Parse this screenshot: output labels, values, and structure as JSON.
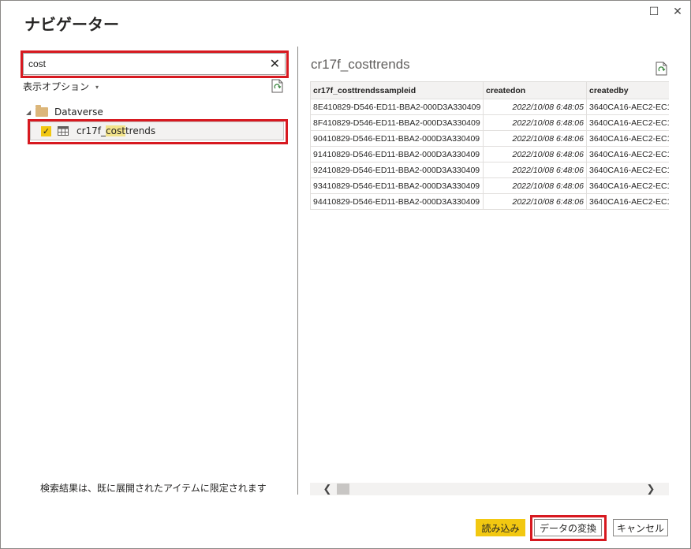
{
  "window": {
    "title": "ナビゲーター",
    "maximize_glyph": "☐",
    "close_glyph": "✕"
  },
  "search": {
    "value": "cost",
    "clear_glyph": "✕"
  },
  "display_options": {
    "label": "表示オプション",
    "caret": "▾"
  },
  "tree": {
    "root": {
      "label": "Dataverse",
      "expander": "◢"
    },
    "items": [
      {
        "label_prefix": "cr17f_",
        "label_match": "cost",
        "label_suffix": "trends",
        "checked": true,
        "check_glyph": "✓"
      }
    ]
  },
  "left_footer": "検索結果は、既に展開されたアイテムに限定されます",
  "preview": {
    "title": "cr17f_costtrends",
    "columns": [
      "cr17f_costtrendssampleid",
      "createdon",
      "createdby"
    ],
    "rows": [
      [
        "8E410829-D546-ED11-BBA2-000D3A330409",
        "2022/10/08 6:48:05",
        "3640CA16-AEC2-EC1"
      ],
      [
        "8F410829-D546-ED11-BBA2-000D3A330409",
        "2022/10/08 6:48:06",
        "3640CA16-AEC2-EC1"
      ],
      [
        "90410829-D546-ED11-BBA2-000D3A330409",
        "2022/10/08 6:48:06",
        "3640CA16-AEC2-EC1"
      ],
      [
        "91410829-D546-ED11-BBA2-000D3A330409",
        "2022/10/08 6:48:06",
        "3640CA16-AEC2-EC1"
      ],
      [
        "92410829-D546-ED11-BBA2-000D3A330409",
        "2022/10/08 6:48:06",
        "3640CA16-AEC2-EC1"
      ],
      [
        "93410829-D546-ED11-BBA2-000D3A330409",
        "2022/10/08 6:48:06",
        "3640CA16-AEC2-EC1"
      ],
      [
        "94410829-D546-ED11-BBA2-000D3A330409",
        "2022/10/08 6:48:06",
        "3640CA16-AEC2-EC1"
      ]
    ],
    "scroll_left_glyph": "❮",
    "scroll_right_glyph": "❯"
  },
  "buttons": {
    "load": "読み込み",
    "transform": "データの変換",
    "cancel": "キャンセル"
  },
  "colors": {
    "accent": "#f2c811",
    "highlight_box": "#d71920"
  }
}
